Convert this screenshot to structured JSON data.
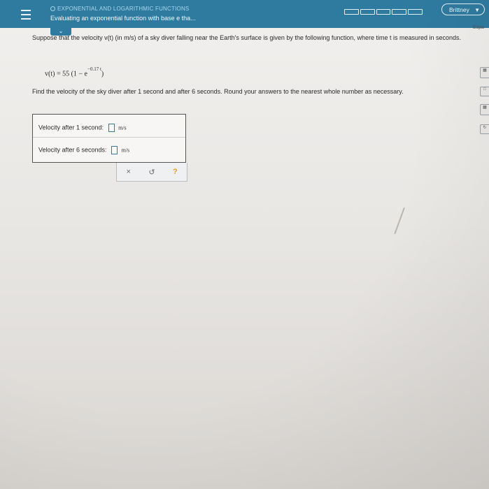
{
  "header": {
    "topic": "EXPONENTIAL AND LOGARITHMIC FUNCTIONS",
    "subtitle": "Evaluating an exponential function with base e tha...",
    "user": "Brittney",
    "progress_segments": 5
  },
  "side_tabs": {
    "esp": "Espa"
  },
  "problem": {
    "intro": "Suppose that the velocity v(t) (in m/s) of a sky diver falling near the Earth's surface is given by the following function, where time t is measured in seconds.",
    "formula_main": "v(t) = 55 (1 − e",
    "formula_exp": "−0.17 t",
    "formula_close": ")",
    "task": "Find the velocity of the sky diver after 1 second and after 6 seconds. Round your answers to the nearest whole number as necessary."
  },
  "answers": {
    "row1_label": "Velocity after 1 second:",
    "row1_value": "",
    "row2_label": "Velocity after 6 seconds:",
    "row2_value": "",
    "unit": "m/s"
  },
  "actions": {
    "clear": "×",
    "undo": "↺",
    "help": "?"
  }
}
